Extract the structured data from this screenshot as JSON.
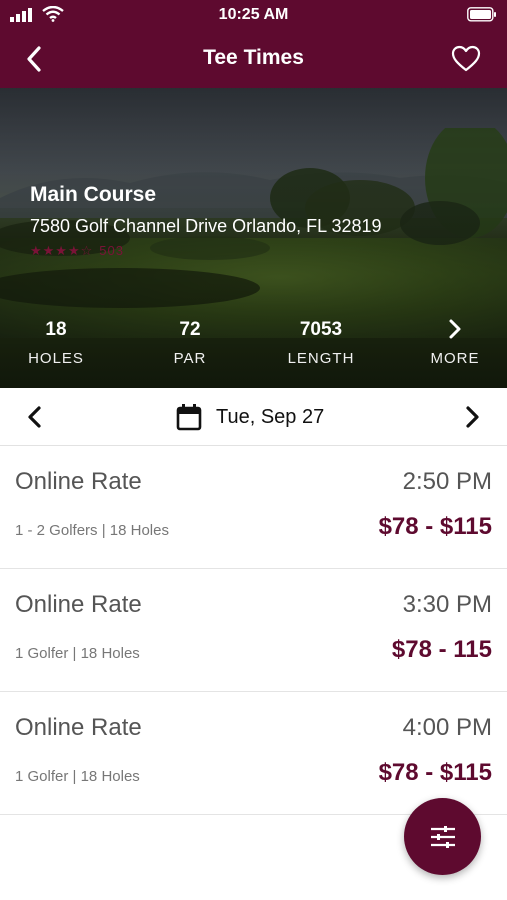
{
  "status_bar": {
    "time": "10:25 AM"
  },
  "header": {
    "title": "Tee Times"
  },
  "course": {
    "name": "Main Course",
    "address": "7580 Golf Channel Drive Orlando, FL 32819",
    "rating_stars": "★★★★☆",
    "rating_count": "503"
  },
  "stats": [
    {
      "value": "18",
      "label": "HOLES"
    },
    {
      "value": "72",
      "label": "PAR"
    },
    {
      "value": "7053",
      "label": "LENGTH"
    },
    {
      "value": "",
      "label": "MORE"
    }
  ],
  "date_selector": {
    "date": "Tue, Sep 27"
  },
  "rates": [
    {
      "title": "Online Rate",
      "time": "2:50 PM",
      "details": "1 - 2 Golfers | 18 Holes",
      "price": "$78 - $115"
    },
    {
      "title": "Online Rate",
      "time": "3:30 PM",
      "details": "1 Golfer | 18 Holes",
      "price": "$78 - 115"
    },
    {
      "title": "Online Rate",
      "time": "4:00 PM",
      "details": "1 Golfer | 18 Holes",
      "price": "$78 - $115"
    }
  ],
  "colors": {
    "brand": "#5e0a2f",
    "background": "#ffffff"
  },
  "icons": [
    "back-icon",
    "heart-icon",
    "chevron-right-icon",
    "calendar-icon",
    "chevron-left-icon",
    "filter-sliders-icon"
  ]
}
